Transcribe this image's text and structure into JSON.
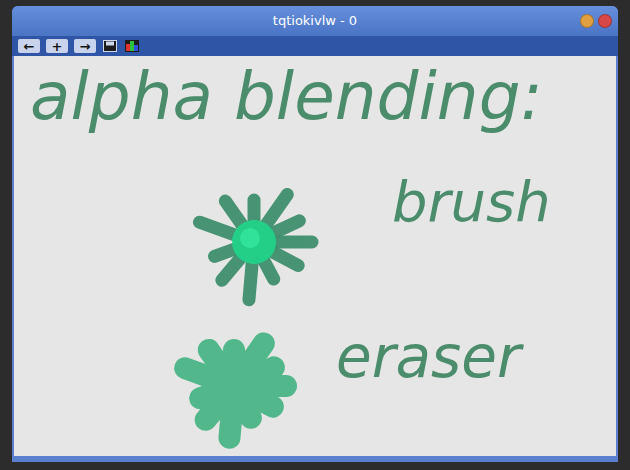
{
  "window": {
    "title": "tqtiokivlw - 0",
    "controls": [
      {
        "name": "minimize",
        "color": "#e0a040"
      },
      {
        "name": "close",
        "color": "#d84848"
      }
    ]
  },
  "toolbar": {
    "buttons": [
      {
        "label": "←",
        "kind": "text"
      },
      {
        "label": "+",
        "kind": "text"
      },
      {
        "label": "→",
        "kind": "text"
      },
      {
        "label": "",
        "kind": "save"
      },
      {
        "label": "",
        "kind": "colors"
      }
    ]
  },
  "canvas": {
    "texts": [
      {
        "text": "alpha blending:",
        "color": "#4a8c6c"
      },
      {
        "text": "brush",
        "color": "#4a8c6c"
      },
      {
        "text": "eraser",
        "color": "#4a8c6c"
      }
    ],
    "splats": [
      {
        "kind": "brush",
        "color": "#3f8f6e"
      },
      {
        "kind": "eraser",
        "color": "#52b88c"
      }
    ]
  }
}
